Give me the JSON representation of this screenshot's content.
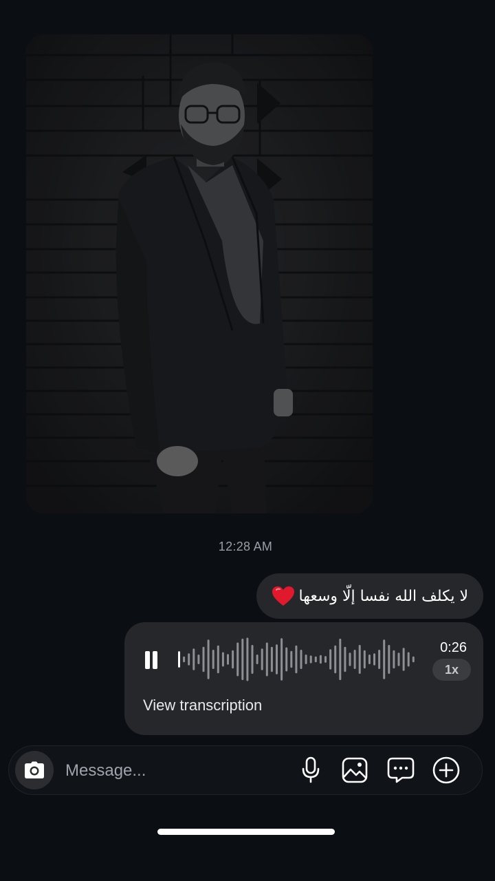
{
  "shared_photo": {
    "icon": "person-photo"
  },
  "timestamp": "12:28 AM",
  "text_message": {
    "text": "لا يكلف الله نفسا إلّا وسعها",
    "emoji": "red-heart-icon"
  },
  "voice_message": {
    "duration": "0:26",
    "speed": "1x",
    "transcription_label": "View transcription",
    "state": "playing",
    "progress": 0.0
  },
  "composer": {
    "placeholder": "Message...",
    "icons": [
      "camera-icon",
      "microphone-icon",
      "gallery-icon",
      "sticker-chat-icon",
      "plus-icon"
    ]
  },
  "colors": {
    "background": "#0b0e13",
    "bubble": "#26272b",
    "heart": "#e0192d",
    "secondary_text": "#9a9ea6"
  }
}
